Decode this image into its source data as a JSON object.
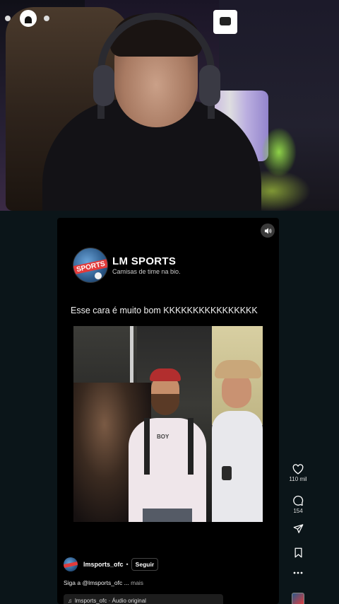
{
  "reel": {
    "account_name": "LM SPORTS",
    "account_subtitle": "Camisas de time na bio.",
    "avatar_text": "SPORTS",
    "caption_headline": "Esse cara é muito bom KKKKKKKKKKKKKKKK",
    "video_shirt_print": "BOY",
    "username": "lmsports_ofc",
    "separator": "•",
    "follow_label": "Seguir",
    "cta_text": "Siga a @lmsports_ofc ...",
    "cta_more": "mais",
    "audio_label": "lmsports_ofc · Áudio original"
  },
  "actions": {
    "likes_count": "110 mil",
    "comments_count": "154"
  },
  "colors": {
    "background": "#0b1519",
    "reel_bg": "#000000",
    "accent_red": "#e23b3b"
  },
  "icons": {
    "mute": "speaker-icon",
    "like": "heart-icon",
    "comment": "comment-icon",
    "share": "send-icon",
    "save": "bookmark-icon",
    "more": "more-icon",
    "audio": "music-note-icon"
  }
}
